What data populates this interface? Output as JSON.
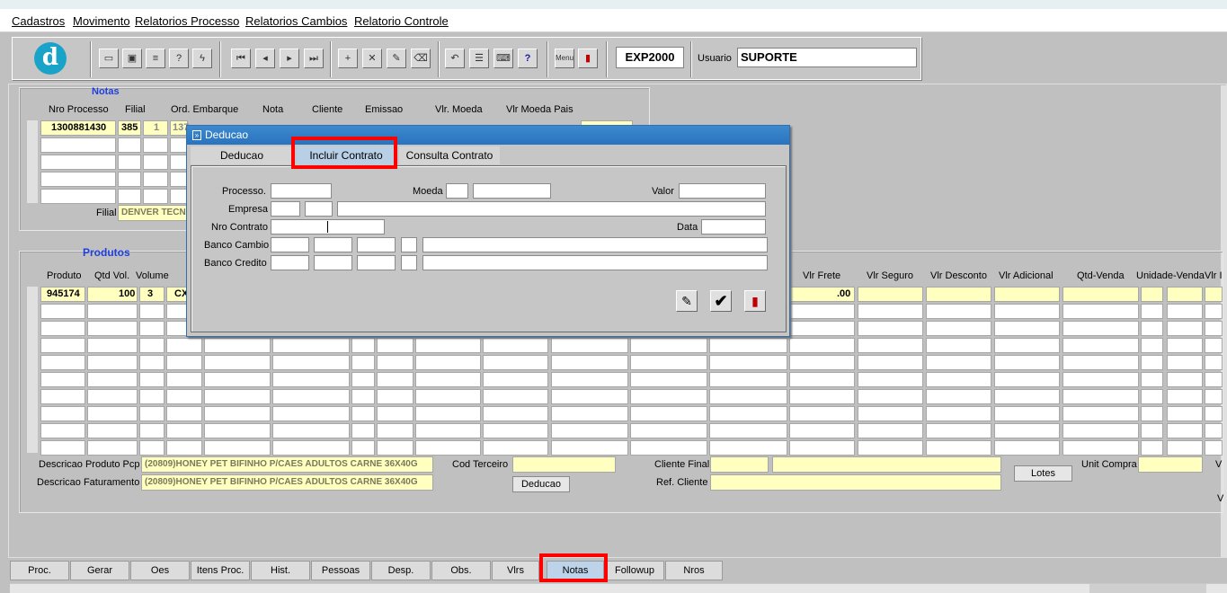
{
  "menu": [
    "Cadastros",
    "Movimento",
    "Relatorios Processo",
    "Relatorios Cambios",
    "Relatorio Controle"
  ],
  "logo_letter": "d",
  "toolbar": {
    "form_code": "EXP2000",
    "user_label": "Usuario",
    "user_value": "SUPORTE",
    "buttons": [
      "save-icon",
      "window-icon",
      "print-icon",
      "query-icon",
      "run-query-icon",
      "first-record-icon",
      "previous-record-icon",
      "next-record-icon",
      "last-record-icon",
      "insert-record-icon",
      "delete-record-icon",
      "edit-icon",
      "clear-icon",
      "undo-icon",
      "list-icon",
      "keys-icon",
      "help-icon",
      "menu-icon",
      "exit-icon"
    ],
    "help_glyph": "?",
    "menu_glyph": "Menu"
  },
  "notas": {
    "title": "Notas",
    "headers": [
      "Nro Processo",
      "Filial",
      "Ord. Embarque",
      "Nota",
      "Cliente",
      "Emissao",
      "Vlr. Moeda",
      "Vlr Moeda Pais"
    ],
    "row1": {
      "nro_processo": "1300881430",
      "filial": "385",
      "ord": "1",
      "ord2": "137"
    },
    "filial_label": "Filial",
    "filial_value": "DENVER TECN"
  },
  "produtos": {
    "title": "Produtos",
    "headers_left": [
      "Produto",
      "Qtd Vol.",
      "Volume"
    ],
    "headers_right": [
      "Vlr Frete",
      "Vlr Seguro",
      "Vlr Desconto",
      "Vlr Adicional",
      "Qtd-Venda",
      "Unidade-Venda",
      "Vlr I"
    ],
    "row1": {
      "produto": "945174",
      "qtd": "100",
      "volume": "3",
      "unit": "CX",
      "frete": ".00"
    },
    "desc_pcp_label": "Descricao Produto Pcp",
    "desc_pcp_value": "(20809)HONEY PET BIFINHO P/CAES ADULTOS CARNE 36X40G",
    "desc_fat_label": "Descricao Faturamento",
    "desc_fat_value": "(20809)HONEY PET BIFINHO P/CAES ADULTOS CARNE 36X40G",
    "cod_terceiro_label": "Cod Terceiro",
    "deducao_button": "Deducao",
    "cliente_final_label": "Cliente Final",
    "ref_cliente_label": "Ref. Cliente",
    "lotes_button": "Lotes",
    "unit_compra_label": "Unit Compra",
    "edge_v": "V",
    "edge_v2": "V"
  },
  "dialog": {
    "title": "Deducao",
    "tabs": [
      "Deducao",
      "Incluir Contrato",
      "Consulta Contrato"
    ],
    "active_tab": "Incluir Contrato",
    "labels": {
      "processo": "Processo.",
      "moeda": "Moeda",
      "valor": "Valor",
      "empresa": "Empresa",
      "nro_contrato": "Nro Contrato",
      "data": "Data",
      "banco_cambio": "Banco Cambio",
      "banco_credito": "Banco Credito"
    },
    "check_glyph": "✔"
  },
  "bottom_tabs": [
    "Proc.",
    "Gerar",
    "Oes",
    "Itens Proc.",
    "Hist.",
    "Pessoas",
    "Desp.",
    "Obs.",
    "Vlrs",
    "Notas",
    "Followup",
    "Nros"
  ],
  "active_bottom_tab": "Notas",
  "highlight_color": "#ff0000"
}
